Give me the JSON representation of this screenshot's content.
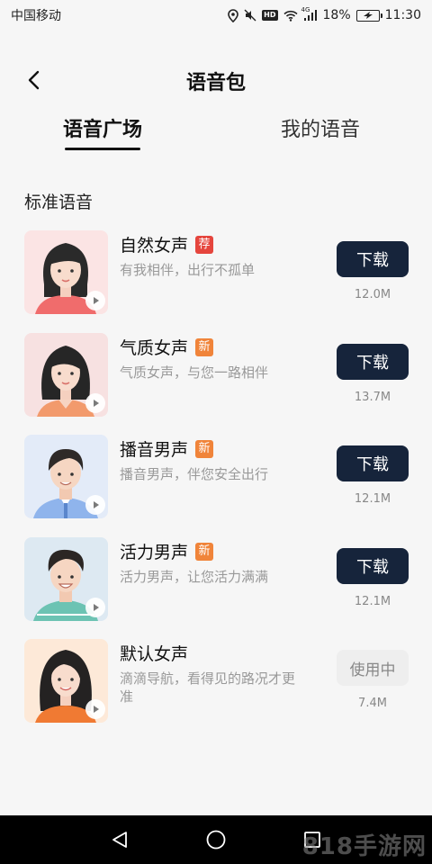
{
  "status_bar": {
    "carrier": "中国移动",
    "network": "4G",
    "battery": "18%",
    "time": "11:30",
    "hd": "HD"
  },
  "header": {
    "title": "语音包"
  },
  "tabs": [
    {
      "label": "语音广场",
      "active": true
    },
    {
      "label": "我的语音",
      "active": false
    }
  ],
  "section": {
    "title": "标准语音"
  },
  "voices": [
    {
      "name": "自然女声",
      "tag": "荐",
      "tag_color": "#e5453d",
      "desc": "有我相伴，出行不孤单",
      "action": "下载",
      "size": "12.0M"
    },
    {
      "name": "气质女声",
      "tag": "新",
      "tag_color": "#f0843a",
      "desc": "气质女声，与您一路相伴",
      "action": "下载",
      "size": "13.7M"
    },
    {
      "name": "播音男声",
      "tag": "新",
      "tag_color": "#f0843a",
      "desc": "播音男声，伴您安全出行",
      "action": "下载",
      "size": "12.1M"
    },
    {
      "name": "活力男声",
      "tag": "新",
      "tag_color": "#f0843a",
      "desc": "活力男声，让您活力满满",
      "action": "下载",
      "size": "12.1M"
    },
    {
      "name": "默认女声",
      "tag": "",
      "tag_color": "",
      "desc": "滴滴导航，看得见的路况才更准",
      "action": "使用中",
      "size": "7.4M"
    }
  ],
  "watermark": "818手游网"
}
